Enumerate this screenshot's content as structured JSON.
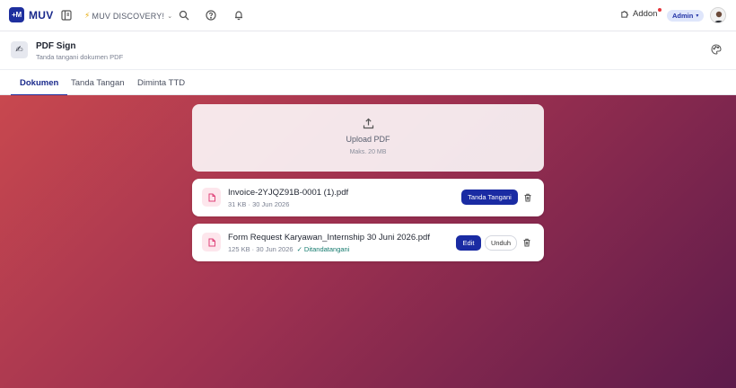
{
  "app": {
    "logo_mark": "+M",
    "logo_text": "MUV"
  },
  "topbar": {
    "workspace": "MUV DISCOVERY!",
    "addon_label": "Addon",
    "admin_label": "Admin"
  },
  "header": {
    "title": "PDF Sign",
    "subtitle": "Tanda tangani dokumen PDF"
  },
  "tabs": [
    {
      "label": "Dokumen",
      "active": true
    },
    {
      "label": "Tanda Tangan",
      "active": false
    },
    {
      "label": "Diminta TTD",
      "active": false
    }
  ],
  "upload": {
    "title": "Upload PDF",
    "subtitle": "Maks. 20 MB"
  },
  "files": [
    {
      "name": "Invoice-2YJQZ91B-0001 (1).pdf",
      "meta": "31 KB · 30 Jun 2026",
      "status": "",
      "primary_label": "Tanda Tangani",
      "secondary_label": ""
    },
    {
      "name": "Form Request Karyawan_Internship 30 Juni 2026.pdf",
      "meta": "125 KB · 30 Jun 2026",
      "status": "✓ Ditandatangani",
      "primary_label": "Edit",
      "secondary_label": "Unduh"
    }
  ],
  "colors": {
    "brand": "#1e2f9e",
    "signed": "#147a6e",
    "notification_dot": "#e5353b"
  }
}
